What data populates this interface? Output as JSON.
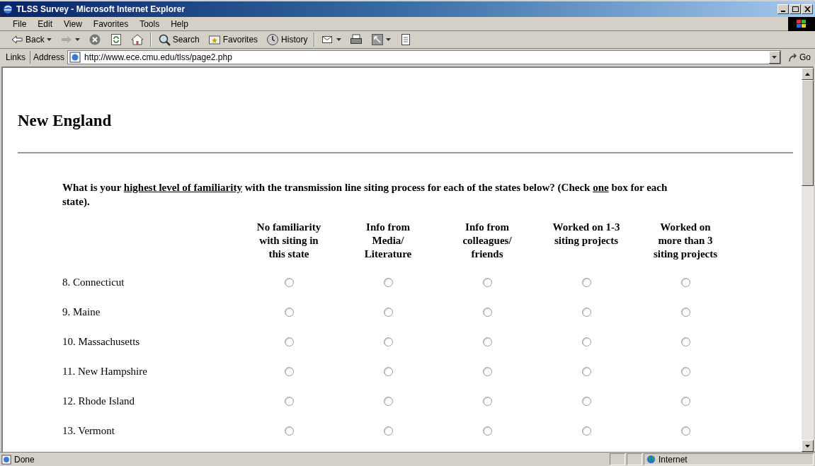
{
  "window": {
    "title": "TLSS Survey - Microsoft Internet Explorer"
  },
  "menu": [
    "File",
    "Edit",
    "View",
    "Favorites",
    "Tools",
    "Help"
  ],
  "toolbar": [
    {
      "kind": "back",
      "label": "Back"
    },
    {
      "kind": "forward"
    },
    {
      "kind": "stop"
    },
    {
      "kind": "refresh"
    },
    {
      "kind": "home"
    },
    {
      "kind": "search",
      "label": "Search"
    },
    {
      "kind": "favorites",
      "label": "Favorites"
    },
    {
      "kind": "history",
      "label": "History"
    },
    {
      "kind": "mail"
    },
    {
      "kind": "print"
    },
    {
      "kind": "edit"
    },
    {
      "kind": "discuss"
    }
  ],
  "address_bar": {
    "links_label": "Links",
    "label": "Address",
    "value": "http://www.ece.cmu.edu/tlss/page2.php",
    "go_label": "Go"
  },
  "page": {
    "heading": "New England",
    "question": [
      {
        "text": "What is your ",
        "underline": false
      },
      {
        "text": "highest level of familiarity",
        "underline": true
      },
      {
        "text": " with the transmission line siting process for each of the states below? (Check ",
        "underline": false
      },
      {
        "text": "one",
        "underline": true
      },
      {
        "text": " box for each state).",
        "underline": false
      }
    ],
    "columns": [
      "No familiarity with siting in this state",
      "Info from Media/ Literature",
      "Info from colleagues/ friends",
      "Worked on 1-3 siting projects",
      "Worked on more than 3 siting projects"
    ],
    "rows": [
      {
        "label": "8. Connecticut",
        "options": [
          {
            "selected": false
          },
          {
            "selected": false
          },
          {
            "selected": false
          },
          {
            "selected": false
          },
          {
            "selected": false
          }
        ]
      },
      {
        "label": "9. Maine",
        "options": [
          {
            "selected": false
          },
          {
            "selected": false
          },
          {
            "selected": false
          },
          {
            "selected": false
          },
          {
            "selected": false
          }
        ]
      },
      {
        "label": "10. Massachusetts",
        "options": [
          {
            "selected": false
          },
          {
            "selected": false
          },
          {
            "selected": false
          },
          {
            "selected": false
          },
          {
            "selected": false
          }
        ]
      },
      {
        "label": "11. New Hampshire",
        "options": [
          {
            "selected": false
          },
          {
            "selected": false
          },
          {
            "selected": false
          },
          {
            "selected": false
          },
          {
            "selected": false
          }
        ]
      },
      {
        "label": "12. Rhode Island",
        "options": [
          {
            "selected": false
          },
          {
            "selected": false
          },
          {
            "selected": false
          },
          {
            "selected": false
          },
          {
            "selected": false
          }
        ]
      },
      {
        "label": "13. Vermont",
        "options": [
          {
            "selected": false
          },
          {
            "selected": false
          },
          {
            "selected": false
          },
          {
            "selected": false
          },
          {
            "selected": false
          }
        ]
      }
    ]
  },
  "status_bar": {
    "text": "Done",
    "zone": "Internet"
  }
}
